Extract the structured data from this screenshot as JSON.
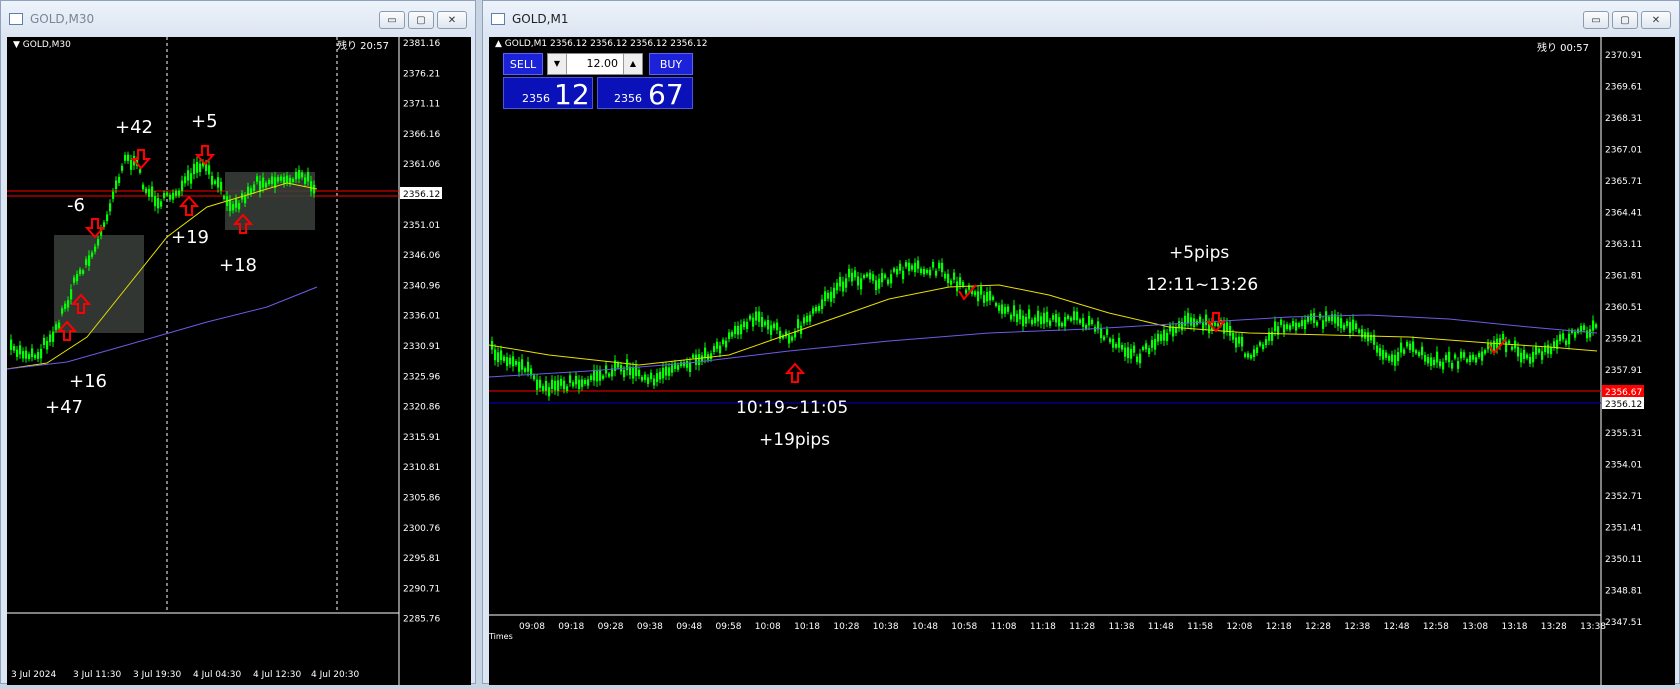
{
  "left_window": {
    "title": "GOLD,M30",
    "chart_label": "GOLD,M30",
    "remaining": "残り 20:57",
    "current_price": "2356.12",
    "price_ticks": [
      "2381.16",
      "2376.21",
      "2371.11",
      "2366.16",
      "2361.06",
      "2356.12",
      "2351.01",
      "2346.06",
      "2340.96",
      "2336.01",
      "2330.91",
      "2325.96",
      "2320.86",
      "2315.91",
      "2310.81",
      "2305.86",
      "2300.76",
      "2295.81",
      "2290.71",
      "2285.76"
    ],
    "time_ticks": [
      "3 Jul 2024",
      "3 Jul 11:30",
      "3 Jul 19:30",
      "4 Jul 04:30",
      "4 Jul 12:30",
      "4 Jul 20:30"
    ],
    "annotations": [
      "+42",
      "+5",
      "-6",
      "+19",
      "+18",
      "+16",
      "+47"
    ],
    "colors": {
      "candle": "#00ff00",
      "ma_fast": "#e8e000",
      "ma_slow": "#6b5ce6",
      "price_line": "#ff0000"
    }
  },
  "right_window": {
    "title": "GOLD,M1",
    "chart_label": "GOLD,M1  2356.12 2356.12 2356.12 2356.12",
    "remaining": "残り 00:57",
    "one_click": {
      "sell_label": "SELL",
      "buy_label": "BUY",
      "lot": "12.00",
      "sell_big": "2356",
      "sell_small": "12",
      "buy_big": "2356",
      "buy_small": "67"
    },
    "bid_price": "2356.12",
    "ask_price": "2356.67",
    "price_ticks": [
      "2370.91",
      "2369.61",
      "2368.31",
      "2367.01",
      "2365.71",
      "2364.41",
      "2363.11",
      "2361.81",
      "2360.51",
      "2359.21",
      "2357.91",
      "2356.61",
      "2355.31",
      "2354.01",
      "2352.71",
      "2351.41",
      "2350.11",
      "2348.81",
      "2347.51"
    ],
    "time_ticks": [
      "09:08",
      "09:18",
      "09:28",
      "09:38",
      "09:48",
      "09:58",
      "10:08",
      "10:18",
      "10:28",
      "10:38",
      "10:48",
      "10:58",
      "11:08",
      "11:18",
      "11:28",
      "11:38",
      "11:48",
      "11:58",
      "12:08",
      "12:18",
      "12:28",
      "12:38",
      "12:48",
      "12:58",
      "13:08",
      "13:18",
      "13:28",
      "13:38"
    ],
    "time_axis_label": "Times",
    "annotations": {
      "trade1_range": "10:19~11:05",
      "trade1_result": "+19pips",
      "trade2_result": "+5pips",
      "trade2_range": "12:11~13:26"
    },
    "colors": {
      "candle": "#00ff00",
      "ma_fast": "#e8e000",
      "ma_slow": "#6b5ce6",
      "ask_line": "#ff0000",
      "bid_line": "#0000cc"
    }
  },
  "window_buttons": {
    "minimize": "▭",
    "maximize": "▢",
    "close": "✕"
  }
}
